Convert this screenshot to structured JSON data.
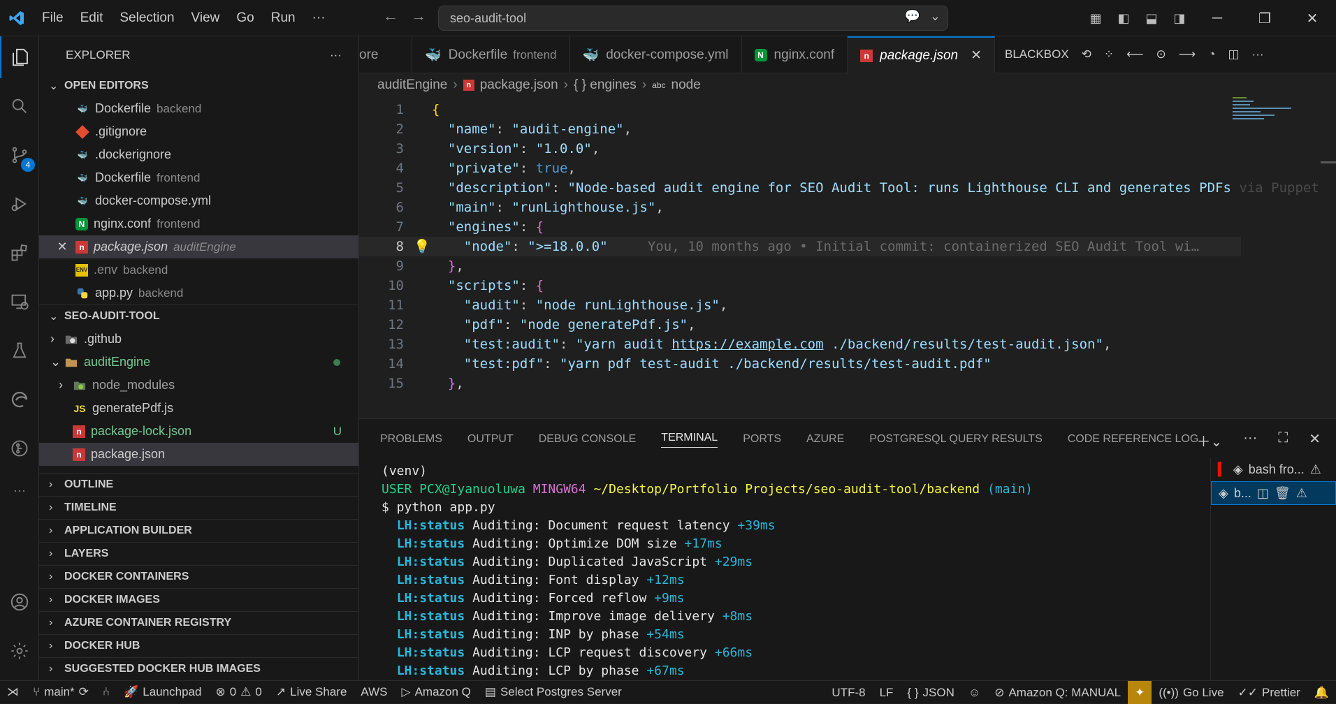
{
  "titlebar": {
    "menus": [
      "File",
      "Edit",
      "Selection",
      "View",
      "Go",
      "Run",
      "···"
    ],
    "search": "seo-audit-tool"
  },
  "activity": {
    "scm_badge": "4"
  },
  "sidebar": {
    "title": "EXPLORER",
    "open_editors_label": "OPEN EDITORS",
    "open_editors": [
      {
        "name": "Dockerfile",
        "desc": "backend",
        "icon": "docker-icon"
      },
      {
        "name": ".gitignore",
        "desc": "",
        "icon": "git-icon"
      },
      {
        "name": ".dockerignore",
        "desc": "",
        "icon": "docker-icon"
      },
      {
        "name": "Dockerfile",
        "desc": "frontend",
        "icon": "docker-icon"
      },
      {
        "name": "docker-compose.yml",
        "desc": "",
        "icon": "docker-icon"
      },
      {
        "name": "nginx.conf",
        "desc": "frontend",
        "icon": "nginx-icon"
      },
      {
        "name": "package.json",
        "desc": "auditEngine",
        "icon": "npm-icon"
      },
      {
        "name": ".env",
        "desc": "backend",
        "icon": "env-icon"
      },
      {
        "name": "app.py",
        "desc": "backend",
        "icon": "python-icon"
      }
    ],
    "project_label": "SEO-AUDIT-TOOL",
    "tree": [
      {
        "name": ".github"
      },
      {
        "name": "auditEngine"
      },
      {
        "name": "node_modules"
      },
      {
        "name": "generatePdf.js"
      },
      {
        "name": "package-lock.json",
        "mark": "U"
      },
      {
        "name": "package.json"
      }
    ],
    "sections": [
      "OUTLINE",
      "TIMELINE",
      "APPLICATION BUILDER",
      "LAYERS",
      "DOCKER CONTAINERS",
      "DOCKER IMAGES",
      "AZURE CONTAINER REGISTRY",
      "DOCKER HUB",
      "SUGGESTED DOCKER HUB IMAGES"
    ]
  },
  "tabs": [
    {
      "name": "ore",
      "desc": ""
    },
    {
      "name": "Dockerfile",
      "desc": "frontend"
    },
    {
      "name": "docker-compose.yml",
      "desc": ""
    },
    {
      "name": "nginx.conf",
      "desc": ""
    },
    {
      "name": "package.json",
      "desc": ""
    }
  ],
  "tab_actions_label": "BLACKBOX",
  "breadcrumb": [
    "auditEngine",
    "package.json",
    "{ } engines",
    "node"
  ],
  "editor": {
    "lines": [
      {
        "n": "1",
        "code": "{"
      },
      {
        "n": "2",
        "code": "  \"name\": \"audit-engine\","
      },
      {
        "n": "3",
        "code": "  \"version\": \"1.0.0\","
      },
      {
        "n": "4",
        "code": "  \"private\": true,"
      },
      {
        "n": "5",
        "code": "  \"description\": \"Node-based audit engine for SEO Audit Tool: runs Lighthouse CLI and generates PDFs via Puppet"
      },
      {
        "n": "6",
        "code": "  \"main\": \"runLighthouse.js\","
      },
      {
        "n": "7",
        "code": "  \"engines\": {"
      },
      {
        "n": "8",
        "code": "    \"node\": \">=18.0.0\""
      },
      {
        "n": "9",
        "code": "  },"
      },
      {
        "n": "10",
        "code": "  \"scripts\": {"
      },
      {
        "n": "11",
        "code": "    \"audit\": \"node runLighthouse.js\","
      },
      {
        "n": "12",
        "code": "    \"pdf\": \"node generatePdf.js\","
      },
      {
        "n": "13",
        "code": "    \"test:audit\": \"yarn audit https://example.com ./backend/results/test-audit.json\","
      },
      {
        "n": "14",
        "code": "    \"test:pdf\": \"yarn pdf test-audit ./backend/results/test-audit.pdf\""
      },
      {
        "n": "15",
        "code": "  },"
      }
    ],
    "blame": "You, 10 months ago • Initial commit: containerized SEO Audit Tool wi…"
  },
  "panel": {
    "tabs": [
      "PROBLEMS",
      "OUTPUT",
      "DEBUG CONSOLE",
      "TERMINAL",
      "PORTS",
      "AZURE",
      "POSTGRESQL QUERY RESULTS",
      "CODE REFERENCE LOG"
    ],
    "venv": "(venv)",
    "prompt_user": "USER PCX@Iyanuoluwa",
    "prompt_env": "MINGW64",
    "prompt_path": "~/Desktop/Portfolio Projects/seo-audit-tool/backend",
    "prompt_branch": "(main)",
    "command": "$ python app.py",
    "audit_lines": [
      {
        "label": "LH:status",
        "text": "Auditing: Document request latency",
        "ms": "+39ms"
      },
      {
        "label": "LH:status",
        "text": "Auditing: Optimize DOM size",
        "ms": "+17ms"
      },
      {
        "label": "LH:status",
        "text": "Auditing: Duplicated JavaScript",
        "ms": "+29ms"
      },
      {
        "label": "LH:status",
        "text": "Auditing: Font display",
        "ms": "+12ms"
      },
      {
        "label": "LH:status",
        "text": "Auditing: Forced reflow",
        "ms": "+9ms"
      },
      {
        "label": "LH:status",
        "text": "Auditing: Improve image delivery",
        "ms": "+8ms"
      },
      {
        "label": "LH:status",
        "text": "Auditing: INP by phase",
        "ms": "+54ms"
      },
      {
        "label": "LH:status",
        "text": "Auditing: LCP request discovery",
        "ms": "+66ms"
      },
      {
        "label": "LH:status",
        "text": "Auditing: LCP by phase",
        "ms": "+67ms"
      }
    ],
    "terminals": [
      "bash fro...",
      "b..."
    ]
  },
  "status": {
    "branch": "main*",
    "launchpad": "Launchpad",
    "errors": "0",
    "warnings": "0",
    "liveshare": "Live Share",
    "aws": "AWS",
    "amazonq": "Amazon Q",
    "postgres": "Select Postgres Server",
    "encoding": "UTF-8",
    "eol": "LF",
    "lang": "JSON",
    "amazonq_manual": "Amazon Q: MANUAL",
    "golive": "Go Live",
    "prettier": "Prettier"
  }
}
